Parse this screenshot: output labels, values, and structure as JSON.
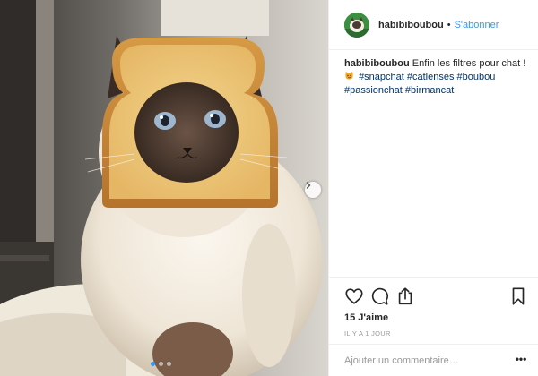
{
  "post": {
    "username": "habibiboubou",
    "separator": "•",
    "follow_label": "S'abonner",
    "caption": {
      "username": "habibiboubou",
      "text": "Enfin les filtres pour chat !",
      "hashtags": [
        "#snapchat",
        "#catlenses",
        "#boubou",
        "#passionchat",
        "#birmancat"
      ]
    },
    "likes": "15 J'aime",
    "time": "IL Y A 1 JOUR",
    "comment": {
      "placeholder": "Ajouter un commentaire…",
      "more": "•••"
    },
    "carousel": {
      "slides": 3,
      "active": 1
    },
    "photo_emoji": "cat-emoji"
  },
  "colors": {
    "link": "#3897f0",
    "hashtag": "#003569",
    "text": "#262626",
    "muted": "#999999",
    "border": "#efefef"
  },
  "icons": {
    "like": "heart-icon",
    "comment": "comment-icon",
    "share": "share-icon",
    "save": "bookmark-icon",
    "next": "chevron-right-icon"
  }
}
